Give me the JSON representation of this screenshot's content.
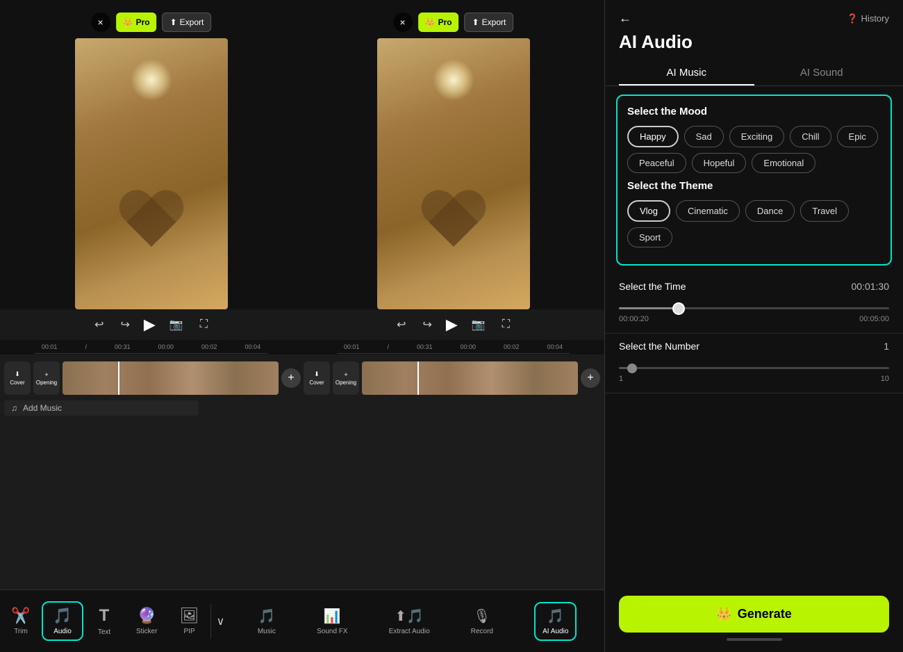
{
  "header": {
    "title": "AI Audio",
    "history_label": "History",
    "back_icon": "←"
  },
  "tabs": [
    {
      "id": "ai-music",
      "label": "AI Music",
      "active": true
    },
    {
      "id": "ai-sound",
      "label": "AI Sound",
      "active": false
    }
  ],
  "video_panels": [
    {
      "id": "panel1",
      "time_current": "00:01",
      "time_total": "00:31",
      "pro_label": "Pro",
      "export_label": "Export",
      "close": "×"
    },
    {
      "id": "panel2",
      "time_current": "00:01",
      "time_total": "00:31",
      "pro_label": "Pro",
      "export_label": "Export",
      "close": "×"
    }
  ],
  "timeline": {
    "markers": [
      "00:00",
      "00:02",
      "00:04",
      "00:00",
      "00:02",
      "00:04"
    ],
    "track_labels": [
      "Cover",
      "Opening",
      "Cover",
      "Opening"
    ],
    "add_music_label": "Add Music"
  },
  "mood": {
    "section_label": "Select the Mood",
    "chips": [
      {
        "id": "happy",
        "label": "Happy",
        "selected": true
      },
      {
        "id": "sad",
        "label": "Sad",
        "selected": false
      },
      {
        "id": "exciting",
        "label": "Exciting",
        "selected": false
      },
      {
        "id": "chill",
        "label": "Chill",
        "selected": false
      },
      {
        "id": "epic",
        "label": "Epic",
        "selected": false
      },
      {
        "id": "peaceful",
        "label": "Peaceful",
        "selected": false
      },
      {
        "id": "hopeful",
        "label": "Hopeful",
        "selected": false
      },
      {
        "id": "emotional",
        "label": "Emotional",
        "selected": false
      }
    ]
  },
  "theme": {
    "section_label": "Select the Theme",
    "chips": [
      {
        "id": "vlog",
        "label": "Vlog",
        "selected": true
      },
      {
        "id": "cinematic",
        "label": "Cinematic",
        "selected": false
      },
      {
        "id": "dance",
        "label": "Dance",
        "selected": false
      },
      {
        "id": "travel",
        "label": "Travel",
        "selected": false
      },
      {
        "id": "sport",
        "label": "Sport",
        "selected": false
      }
    ]
  },
  "time_selector": {
    "label": "Select the Time",
    "value": "00:01:30",
    "min": "00:00:20",
    "max": "00:05:00",
    "fill_percent": 22
  },
  "number_selector": {
    "label": "Select the Number",
    "value": "1",
    "min": "1",
    "max": "10",
    "fill_percent": 5
  },
  "bottom_tools_primary": [
    {
      "id": "trim",
      "label": "Trim",
      "icon": "✂"
    },
    {
      "id": "audio",
      "label": "Audio",
      "icon": "♪",
      "active": true
    },
    {
      "id": "text",
      "label": "Text",
      "icon": "T"
    },
    {
      "id": "sticker",
      "label": "Sticker",
      "icon": "●"
    },
    {
      "id": "pip",
      "label": "PIP",
      "icon": "⊞"
    }
  ],
  "bottom_tools_secondary": [
    {
      "id": "music",
      "label": "Music",
      "icon": "♩"
    },
    {
      "id": "sound-fx",
      "label": "Sound FX",
      "icon": "▐▌"
    },
    {
      "id": "extract-audio",
      "label": "Extract Audio",
      "icon": "↑♪"
    },
    {
      "id": "record",
      "label": "Record",
      "icon": "🎙"
    },
    {
      "id": "ai-audio",
      "label": "AI Audio",
      "icon": "♪↑",
      "active": true
    }
  ],
  "generate_button": {
    "label": "Generate",
    "icon": "👑"
  },
  "colors": {
    "accent": "#00e5cc",
    "pro_bg": "#b8f400",
    "generate_bg": "#b8f400"
  }
}
